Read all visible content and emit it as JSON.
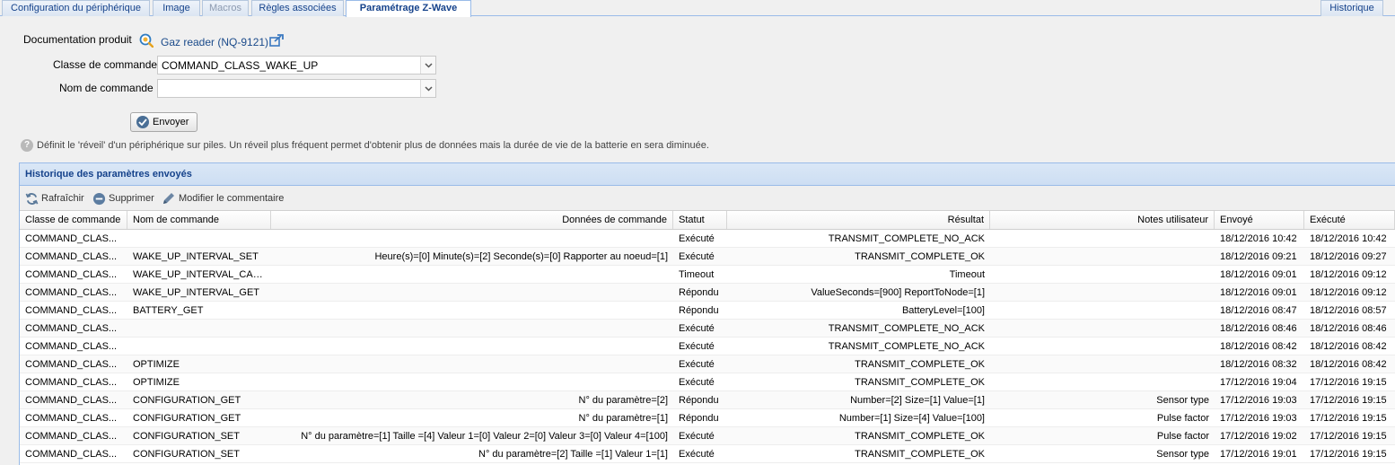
{
  "tabs": {
    "device_config": "Configuration du périphérique",
    "image": "Image",
    "macros": "Macros",
    "rules": "Règles associées",
    "zwave": "Paramétrage Z-Wave",
    "history": "Historique"
  },
  "form": {
    "doc_label": "Documentation produit",
    "doc_link": "Gaz reader (NQ-9121)",
    "class_label": "Classe de commande",
    "class_value": "COMMAND_CLASS_WAKE_UP",
    "name_label": "Nom de commande",
    "name_value": "",
    "send_label": "Envoyer",
    "help_text": "Définit le 'réveil' d'un périphérique sur piles. Un réveil plus fréquent permet d'obtenir plus de données mais la durée de vie de la batterie en sera diminuée."
  },
  "panel": {
    "title": "Historique des paramètres envoyés",
    "toolbar": {
      "refresh": "Rafraîchir",
      "delete": "Supprimer",
      "edit_comment": "Modifier le commentaire"
    },
    "columns": {
      "class": "Classe de commande",
      "name": "Nom de commande",
      "data": "Données de commande",
      "status": "Statut",
      "result": "Résultat",
      "notes": "Notes utilisateur",
      "sent": "Envoyé",
      "executed": "Exécuté"
    },
    "rows": [
      {
        "class": "COMMAND_CLAS...",
        "name": "",
        "data": "",
        "status": "Exécuté",
        "result": "TRANSMIT_COMPLETE_NO_ACK",
        "notes": "",
        "sent": "18/12/2016 10:42",
        "executed": "18/12/2016 10:42"
      },
      {
        "class": "COMMAND_CLAS...",
        "name": "WAKE_UP_INTERVAL_SET",
        "data": "Heure(s)=[0] Minute(s)=[2] Seconde(s)=[0] Rapporter au noeud=[1]",
        "status": "Exécuté",
        "result": "TRANSMIT_COMPLETE_OK",
        "notes": "",
        "sent": "18/12/2016 09:21",
        "executed": "18/12/2016 09:27"
      },
      {
        "class": "COMMAND_CLAS...",
        "name": "WAKE_UP_INTERVAL_CAP...",
        "data": "",
        "status": "Timeout",
        "result": "Timeout",
        "notes": "",
        "sent": "18/12/2016 09:01",
        "executed": "18/12/2016 09:12"
      },
      {
        "class": "COMMAND_CLAS...",
        "name": "WAKE_UP_INTERVAL_GET",
        "data": "",
        "status": "Répondu",
        "result": "ValueSeconds=[900] ReportToNode=[1]",
        "notes": "",
        "sent": "18/12/2016 09:01",
        "executed": "18/12/2016 09:12"
      },
      {
        "class": "COMMAND_CLAS...",
        "name": "BATTERY_GET",
        "data": "",
        "status": "Répondu",
        "result": "BatteryLevel=[100]",
        "notes": "",
        "sent": "18/12/2016 08:47",
        "executed": "18/12/2016 08:57"
      },
      {
        "class": "COMMAND_CLAS...",
        "name": "",
        "data": "",
        "status": "Exécuté",
        "result": "TRANSMIT_COMPLETE_NO_ACK",
        "notes": "",
        "sent": "18/12/2016 08:46",
        "executed": "18/12/2016 08:46"
      },
      {
        "class": "COMMAND_CLAS...",
        "name": "",
        "data": "",
        "status": "Exécuté",
        "result": "TRANSMIT_COMPLETE_NO_ACK",
        "notes": "",
        "sent": "18/12/2016 08:42",
        "executed": "18/12/2016 08:42"
      },
      {
        "class": "COMMAND_CLAS...",
        "name": "OPTIMIZE",
        "data": "",
        "status": "Exécuté",
        "result": "TRANSMIT_COMPLETE_OK",
        "notes": "",
        "sent": "18/12/2016 08:32",
        "executed": "18/12/2016 08:42"
      },
      {
        "class": "COMMAND_CLAS...",
        "name": "OPTIMIZE",
        "data": "",
        "status": "Exécuté",
        "result": "TRANSMIT_COMPLETE_OK",
        "notes": "",
        "sent": "17/12/2016 19:04",
        "executed": "17/12/2016 19:15"
      },
      {
        "class": "COMMAND_CLAS...",
        "name": "CONFIGURATION_GET",
        "data": "N° du paramètre=[2]",
        "status": "Répondu",
        "result": "Number=[2] Size=[1] Value=[1]",
        "notes": "Sensor type",
        "sent": "17/12/2016 19:03",
        "executed": "17/12/2016 19:15"
      },
      {
        "class": "COMMAND_CLAS...",
        "name": "CONFIGURATION_GET",
        "data": "N° du paramètre=[1]",
        "status": "Répondu",
        "result": "Number=[1] Size=[4] Value=[100]",
        "notes": "Pulse factor",
        "sent": "17/12/2016 19:03",
        "executed": "17/12/2016 19:15"
      },
      {
        "class": "COMMAND_CLAS...",
        "name": "CONFIGURATION_SET",
        "data": "N° du paramètre=[1] Taille =[4] Valeur 1=[0] Valeur 2=[0] Valeur 3=[0] Valeur 4=[100]",
        "status": "Exécuté",
        "result": "TRANSMIT_COMPLETE_OK",
        "notes": "Pulse factor",
        "sent": "17/12/2016 19:02",
        "executed": "17/12/2016 19:15"
      },
      {
        "class": "COMMAND_CLAS...",
        "name": "CONFIGURATION_SET",
        "data": "N° du paramètre=[2] Taille =[1] Valeur 1=[1]",
        "status": "Exécuté",
        "result": "TRANSMIT_COMPLETE_OK",
        "notes": "Sensor type",
        "sent": "17/12/2016 19:01",
        "executed": "17/12/2016 19:15"
      }
    ]
  }
}
